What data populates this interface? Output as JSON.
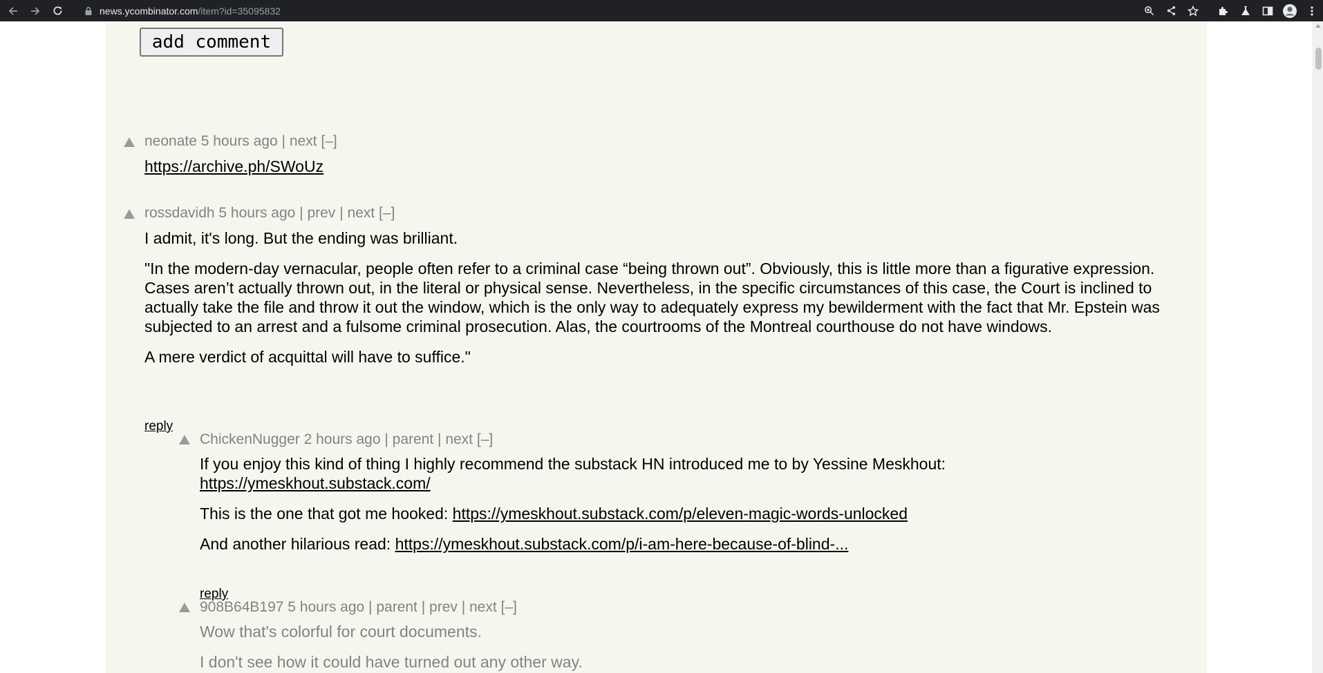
{
  "browser": {
    "url_host": "news.ycombinator.com",
    "url_path": "/item?id=35095832"
  },
  "page": {
    "add_comment_label": "add comment"
  },
  "comments": [
    {
      "user": "neonate",
      "age": "5 hours ago",
      "links": [
        "next",
        "[–]"
      ],
      "link_text": "https://archive.ph/SWoUz"
    },
    {
      "user": "rossdavidh",
      "age": "5 hours ago",
      "links": [
        "prev",
        "next",
        "[–]"
      ],
      "paragraphs": [
        "I admit, it's long. But the ending was brilliant.",
        "\"In the modern-day vernacular, people often refer to a criminal case “being thrown out”. Obviously, this is little more than a figurative expression. Cases aren’t actually thrown out, in the literal or physical sense. Nevertheless, in the specific circumstances of this case, the Court is inclined to actually take the file and throw it out the window, which is the only way to adequately express my bewilderment with the fact that Mr. Epstein was subjected to an arrest and a fulsome criminal prosecution. Alas, the courtrooms of the Montreal courthouse do not have windows.",
        "A mere verdict of acquittal will have to suffice.\""
      ],
      "reply_label": "reply"
    },
    {
      "user": "ChickenNugger",
      "age": "2 hours ago",
      "links": [
        "parent",
        "next",
        "[–]"
      ],
      "p1_text": "If you enjoy this kind of thing I highly recommend the substack HN introduced me to by Yessine Meskhout:",
      "p1_link": "https://ymeskhout.substack.com/",
      "p2_text": "This is the one that got me hooked:",
      "p2_link": "https://ymeskhout.substack.com/p/eleven-magic-words-unlocked",
      "p3_text": "And another hilarious read:",
      "p3_link": "https://ymeskhout.substack.com/p/i-am-here-because-of-blind-...",
      "reply_label": "reply"
    },
    {
      "user": "908B64B197",
      "age": "5 hours ago",
      "links": [
        "parent",
        "prev",
        "next",
        "[–]"
      ],
      "paragraphs": [
        "Wow that's colorful for court documents.",
        "I don't see how it could have turned out any other way."
      ]
    }
  ],
  "icons": {
    "back": "arrow-left-icon",
    "forward": "arrow-right-icon",
    "reload": "reload-icon",
    "lock": "lock-icon",
    "zoom": "zoom-icon",
    "share": "share-icon",
    "bookmark": "star-icon",
    "extensions": "puzzle-icon",
    "labs": "flask-icon",
    "sidepanel": "side-panel-icon",
    "profile": "profile-icon",
    "menu": "kebab-menu-icon"
  },
  "colors": {
    "chrome_bg": "#202124",
    "hn_bg": "#f6f6ef",
    "meta_grey": "#828282"
  }
}
